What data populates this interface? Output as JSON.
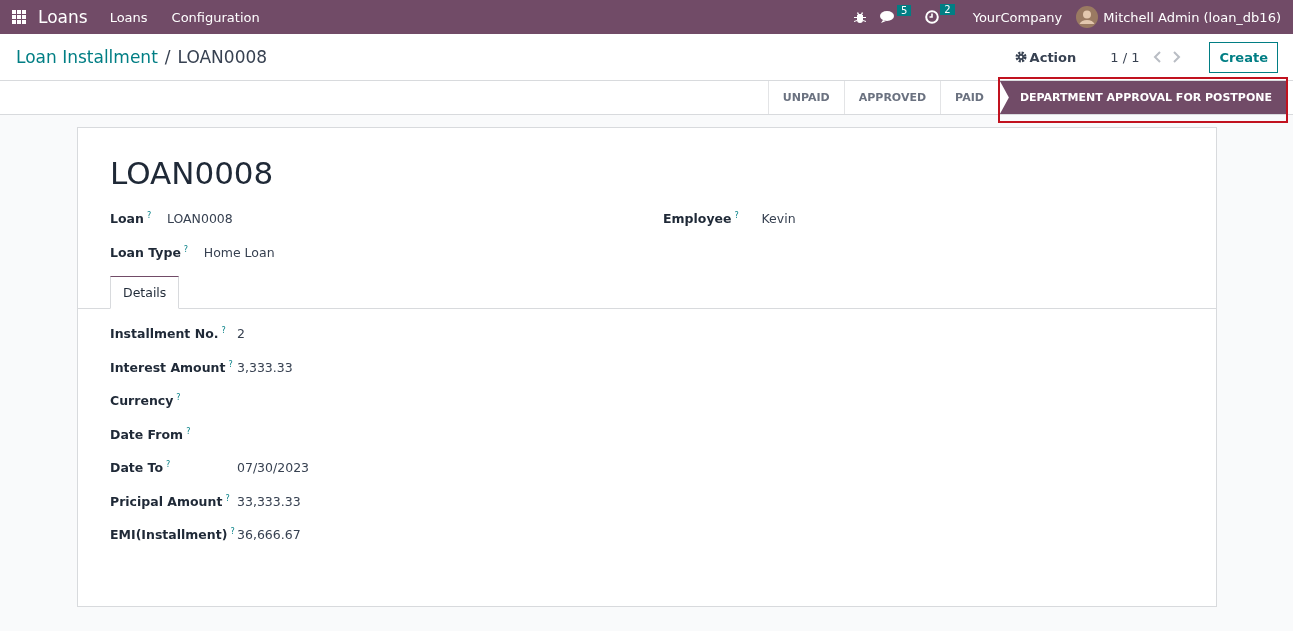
{
  "navbar": {
    "app_name": "Loans",
    "menus": [
      "Loans",
      "Configuration"
    ],
    "messages_count": "5",
    "activities_count": "2",
    "company": "YourCompany",
    "user": "Mitchell Admin (loan_db16)"
  },
  "control_panel": {
    "breadcrumb": "Loan Installment",
    "separator": "/",
    "current": "LOAN0008",
    "action": "Action",
    "pager": "1 / 1",
    "create": "Create"
  },
  "stages": [
    {
      "label": "UNPAID",
      "selected": false,
      "highlighted": false
    },
    {
      "label": "APPROVED",
      "selected": false,
      "highlighted": false
    },
    {
      "label": "PAID",
      "selected": false,
      "highlighted": false
    },
    {
      "label": "DEPARTMENT APPROVAL FOR POSTPONE",
      "selected": true,
      "highlighted": true
    }
  ],
  "form": {
    "title": "LOAN0008",
    "left_fields": [
      {
        "label": "Loan",
        "help": "?",
        "value": "LOAN0008"
      },
      {
        "label": "Loan Type",
        "help": "?",
        "value": "Home Loan"
      }
    ],
    "right_fields": [
      {
        "label": "Employee",
        "help": "?",
        "value": "Kevin"
      }
    ],
    "tabs": [
      {
        "label": "Details",
        "selected": true
      }
    ],
    "detail_fields": [
      {
        "label": "Installment No.",
        "help": "?",
        "value": "2"
      },
      {
        "label": "Interest Amount",
        "help": "?",
        "value": "3,333.33"
      },
      {
        "label": "Currency",
        "help": "?"
      },
      {
        "label": "Date From",
        "help": "?"
      },
      {
        "label": "Date To",
        "help": "?",
        "value": "07/30/2023"
      },
      {
        "label": "Pricipal Amount",
        "help": "?",
        "value": "33,333.33"
      },
      {
        "label": "EMI(Installment)",
        "help": "?",
        "value": "36,666.67"
      }
    ]
  }
}
